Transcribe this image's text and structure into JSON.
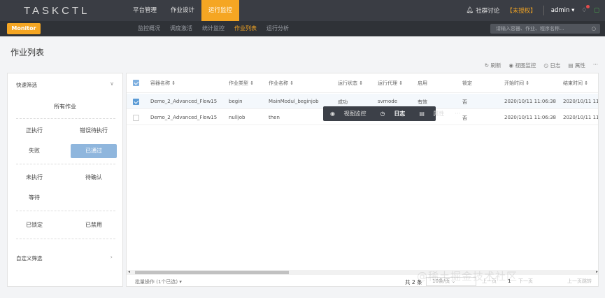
{
  "brand": {
    "logo": "TASKCTL"
  },
  "topnav": {
    "items": [
      {
        "label": "平台管理"
      },
      {
        "label": "作业设计"
      },
      {
        "label": "运行监控"
      }
    ],
    "community": "社群讨论",
    "unauthorized": "【未授权】",
    "user": "admin ▾",
    "accent": "#f5a623"
  },
  "subbar": {
    "monitor": "Monitor",
    "items": [
      {
        "label": "监控概况"
      },
      {
        "label": "调度激活"
      },
      {
        "label": "统计监控"
      },
      {
        "label": "作业列表"
      },
      {
        "label": "运行分析"
      }
    ],
    "search_placeholder": "请输入容器、作业、程序名称..."
  },
  "page": {
    "title": "作业列表"
  },
  "toolbar": {
    "refresh": "刷新",
    "view_monitor": "视图监控",
    "log": "日志",
    "properties": "属性",
    "more": "···"
  },
  "filters": {
    "quick": "快速筛选",
    "all": "所有作业",
    "running": "正执行",
    "error": "错误待执行",
    "failed": "失败",
    "passed": "已通过",
    "not_run": "未执行",
    "pending": "待确认",
    "waiting": "等待",
    "locked": "已锁定",
    "disabled": "已禁用",
    "custom": "自定义筛选",
    "active_color": "#8fb6dd"
  },
  "table": {
    "headers": {
      "container": "容器名称 ⇕",
      "type": "作业类型 ⇕",
      "name": "作业名称 ⇕",
      "status": "运行状态 ⇕",
      "agent": "运行代理 ⇕",
      "enabled": "启用",
      "locked": "锁定",
      "start": "开始时间 ⇕",
      "end": "结束时间 ⇕"
    },
    "rows": [
      {
        "container": "Demo_2_Advanced_Flow15",
        "type": "begin",
        "name": "MainModul_beginjob",
        "status": "成功",
        "agent": "svrnode",
        "enabled": "有效",
        "locked": "否",
        "start": "2020/10/11 11:06:38",
        "end": "2020/10/11 11:"
      },
      {
        "container": "Demo_2_Advanced_Flow15",
        "type": "nulljob",
        "name": "then",
        "status": "",
        "agent": "",
        "enabled": "",
        "locked": "否",
        "start": "2020/10/11 11:06:38",
        "end": "2020/10/11 11:"
      }
    ]
  },
  "row_actions": {
    "view_monitor": "视图监控",
    "log": "日志",
    "properties": "属性",
    "more": "···"
  },
  "footer": {
    "batch": "批量操作 (1个已选)  ▾",
    "total": "共 2 条",
    "page_size": "10条/页  ⌄",
    "prev": "上一页",
    "page": "1",
    "next": "下一页",
    "last": "上一页跳转"
  },
  "watermark": "@稀土掘金技术社区"
}
